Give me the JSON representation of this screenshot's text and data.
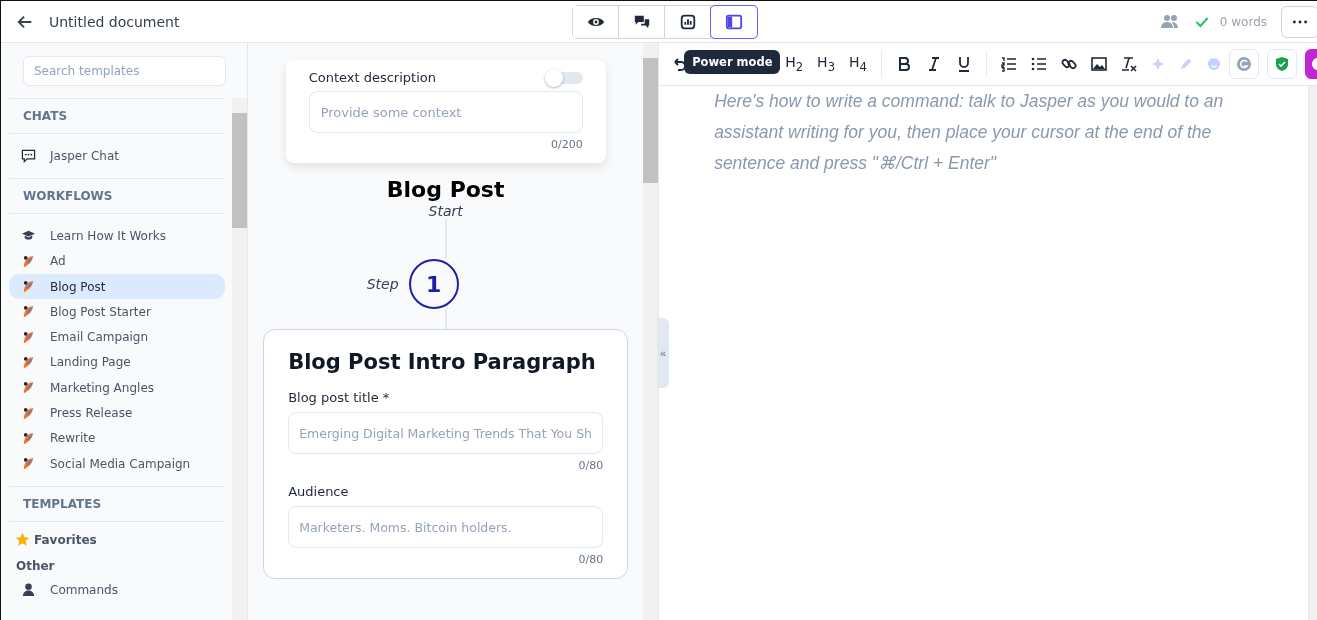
{
  "header": {
    "title": "Untitled document",
    "words": "0 words",
    "saved": true
  },
  "modes": [
    {
      "kind": "preview",
      "selected": false
    },
    {
      "kind": "chat",
      "selected": false
    },
    {
      "kind": "chart",
      "selected": false
    },
    {
      "kind": "power",
      "selected": true
    }
  ],
  "tooltip": "Power mode",
  "sidebar": {
    "search_placeholder": "Search templates",
    "sections": [
      {
        "title": "CHATS",
        "items": [
          {
            "label": "Jasper Chat",
            "kind": "chat",
            "selected": false
          }
        ]
      },
      {
        "title": "WORKFLOWS",
        "items": [
          {
            "label": "Learn How It Works",
            "kind": "cap",
            "selected": false
          },
          {
            "label": "Ad",
            "kind": "rocket",
            "selected": false
          },
          {
            "label": "Blog Post",
            "kind": "rocket",
            "selected": true
          },
          {
            "label": "Blog Post Starter",
            "kind": "rocket",
            "selected": false
          },
          {
            "label": "Email Campaign",
            "kind": "rocket",
            "selected": false
          },
          {
            "label": "Landing Page",
            "kind": "rocket",
            "selected": false
          },
          {
            "label": "Marketing Angles",
            "kind": "rocket",
            "selected": false
          },
          {
            "label": "Press Release",
            "kind": "rocket",
            "selected": false
          },
          {
            "label": "Rewrite",
            "kind": "rocket",
            "selected": false
          },
          {
            "label": "Social Media Campaign",
            "kind": "rocket",
            "selected": false
          }
        ]
      },
      {
        "title": "TEMPLATES",
        "favorites": "Favorites",
        "group": "Other",
        "items": [
          {
            "label": "Commands",
            "kind": "person",
            "selected": false
          }
        ]
      }
    ]
  },
  "context": {
    "label": "Context description",
    "on": false,
    "placeholder": "Provide some context",
    "counter": "0/200"
  },
  "workflow": {
    "title": "Blog Post",
    "start": "Start",
    "step_label": "Step",
    "step": "1"
  },
  "step_card": {
    "title": "Blog Post Intro Paragraph",
    "fields": [
      {
        "label": "Blog post title *",
        "placeholder": "Emerging Digital Marketing Trends That You Sh",
        "counter": "0/80"
      },
      {
        "label": "Audience",
        "placeholder": "Marketers. Moms. Bitcoin holders.",
        "counter": "0/80"
      }
    ]
  },
  "toolbar": {
    "headings": [
      "H$_{2}$",
      "H$_{3}$",
      "H$_{4}$"
    ]
  },
  "collapse": "«",
  "editor": {
    "placeholder": "Here's how to write a command: talk to Jasper as you would to an assistant writing for you, then place your cursor at the end of the sentence and press \"⌘/Ctrl + Enter\""
  }
}
